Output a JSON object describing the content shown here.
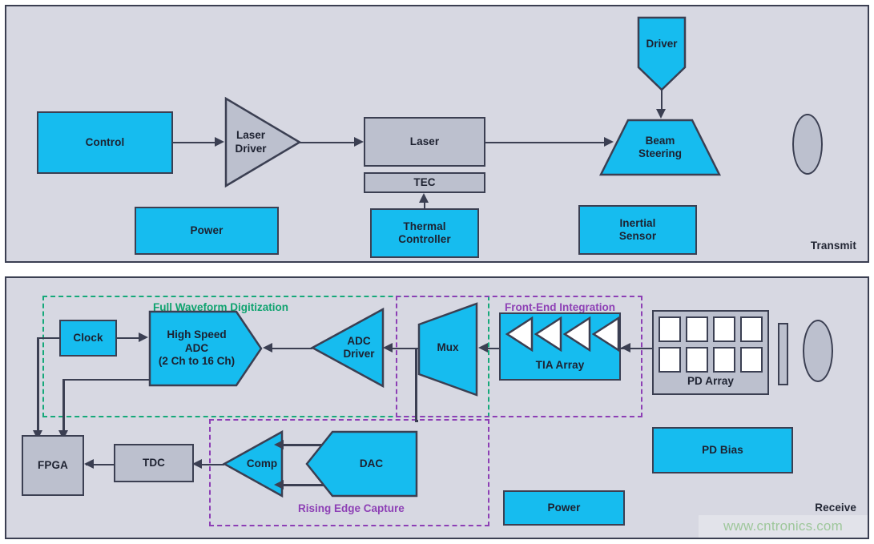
{
  "colors": {
    "cyan": "#16bcef",
    "gray": "#bcc0ce",
    "panel_bg": "#d7d8e2",
    "stroke": "#3b3f52",
    "group_green": "#16a97a",
    "group_purple": "#8d3fb5"
  },
  "transmit": {
    "panel_label": "Transmit",
    "blocks": {
      "control": "Control",
      "laser_driver_line1": "Laser",
      "laser_driver_line2": "Driver",
      "laser": "Laser",
      "tec": "TEC",
      "thermal_controller_line1": "Thermal",
      "thermal_controller_line2": "Controller",
      "power": "Power",
      "driver": "Driver",
      "beam_steering_line1": "Beam",
      "beam_steering_line2": "Steering",
      "inertial_sensor_line1": "Inertial",
      "inertial_sensor_line2": "Sensor",
      "tx_lens": "transmit-lens"
    }
  },
  "receive": {
    "panel_label": "Receive",
    "groups": {
      "full_waveform": "Full Waveform Digitization",
      "front_end": "Front-End Integration",
      "rising_edge": "Rising Edge Capture"
    },
    "blocks": {
      "clock": "Clock",
      "high_speed_adc_line1": "High Speed",
      "high_speed_adc_line2": "ADC",
      "high_speed_adc_line3": "(2 Ch to 16 Ch)",
      "adc_driver_line1": "ADC",
      "adc_driver_line2": "Driver",
      "mux": "Mux",
      "tia_array": "TIA Array",
      "pd_array": "PD Array",
      "pd_bias": "PD Bias",
      "power": "Power",
      "fpga": "FPGA",
      "tdc": "TDC",
      "comp": "Comp",
      "dac": "DAC",
      "rx_filter": "receive-optical-filter",
      "rx_lens": "receive-lens"
    },
    "pd_array_cells": [
      [
        "pd-1",
        "pd-2",
        "pd-3",
        "pd-4"
      ],
      [
        "pd-5",
        "pd-6",
        "pd-7",
        "pd-8"
      ]
    ],
    "tia_amp_count": 4
  },
  "watermark": {
    "text": "www.cntronics.com"
  }
}
